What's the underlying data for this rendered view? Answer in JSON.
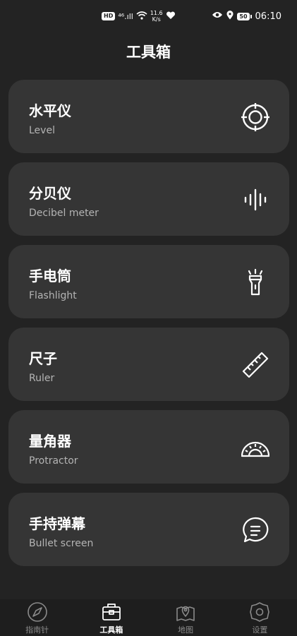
{
  "status_bar": {
    "hd": "HD",
    "signal": "⁴⁶.ıll",
    "net_speed_value": "11.6",
    "net_speed_unit": "K/s",
    "battery": "50",
    "time": "06:10"
  },
  "header": {
    "title": "工具箱"
  },
  "tools": [
    {
      "title": "水平仪",
      "subtitle": "Level",
      "icon": "level-icon"
    },
    {
      "title": "分贝仪",
      "subtitle": "Decibel meter",
      "icon": "decibel-icon"
    },
    {
      "title": "手电筒",
      "subtitle": "Flashlight",
      "icon": "flashlight-icon"
    },
    {
      "title": "尺子",
      "subtitle": "Ruler",
      "icon": "ruler-icon"
    },
    {
      "title": "量角器",
      "subtitle": "Protractor",
      "icon": "protractor-icon"
    },
    {
      "title": "手持弹幕",
      "subtitle": "Bullet screen",
      "icon": "bullet-screen-icon"
    }
  ],
  "bottom_nav": [
    {
      "label": "指南针",
      "icon": "compass-icon",
      "active": false
    },
    {
      "label": "工具箱",
      "icon": "toolbox-icon",
      "active": true
    },
    {
      "label": "地图",
      "icon": "map-icon",
      "active": false
    },
    {
      "label": "设置",
      "icon": "settings-icon",
      "active": false
    }
  ],
  "colors": {
    "background": "#232323",
    "card": "#353535",
    "text_primary": "#ffffff",
    "text_secondary": "#b4b4b4",
    "nav_inactive": "#8a8a8a"
  }
}
